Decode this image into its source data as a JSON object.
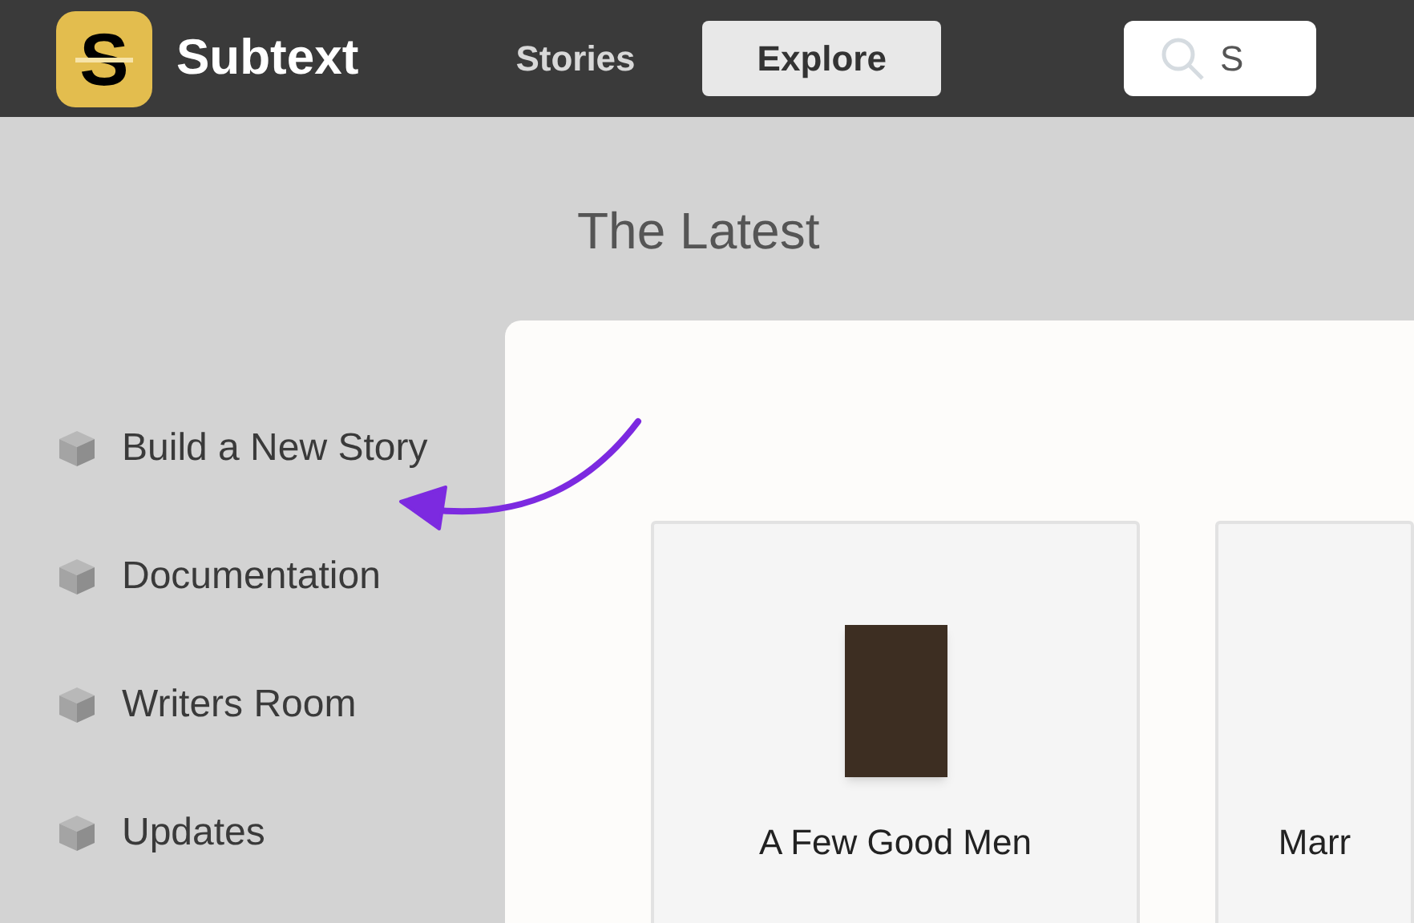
{
  "header": {
    "logo_glyph": "S",
    "app_name": "Subtext",
    "nav": [
      {
        "label": "Stories",
        "selected": false
      },
      {
        "label": "Explore",
        "selected": true
      }
    ],
    "search": {
      "placeholder": "S"
    }
  },
  "page_title": "The Latest",
  "sidebar": {
    "items": [
      {
        "label": "Build a New Story"
      },
      {
        "label": "Documentation"
      },
      {
        "label": "Writers Room"
      },
      {
        "label": "Updates"
      }
    ]
  },
  "stories": [
    {
      "title": "A Few Good Men",
      "poster": true
    },
    {
      "title": "Marr",
      "poster": false
    }
  ]
}
